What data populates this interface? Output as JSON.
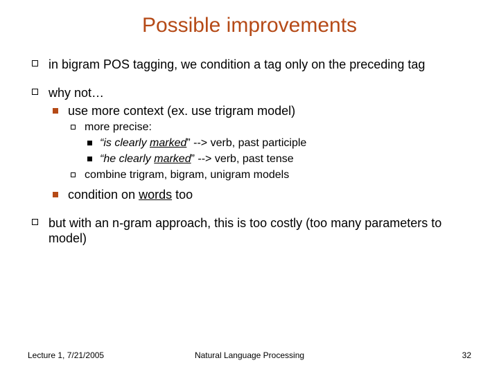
{
  "title": "Possible improvements",
  "bullets": {
    "b1": "in bigram POS tagging, we condition a tag only on the preceding tag",
    "b2": "why not…",
    "b2a": "use more context (ex. use trigram model)",
    "b2a1": "more precise:",
    "b2a1a_pre": "“",
    "b2a1a_is": "is",
    "b2a1a_mid": " clearly ",
    "b2a1a_marked": "marked",
    "b2a1a_post": "” --> verb, past participle",
    "b2a1b_pre": "“",
    "b2a1b_he": "he",
    "b2a1b_mid": " clearly ",
    "b2a1b_marked": "marked",
    "b2a1b_post": "” --> verb, past tense",
    "b2a2": "combine trigram, bigram, unigram models",
    "b2b_pre": "condition on ",
    "b2b_words": "words",
    "b2b_post": " too",
    "b3": "but with an n-gram approach, this is too costly (too many parameters to model)"
  },
  "footer": {
    "left": "Lecture 1, 7/21/2005",
    "center": "Natural Language Processing",
    "right": "32"
  }
}
